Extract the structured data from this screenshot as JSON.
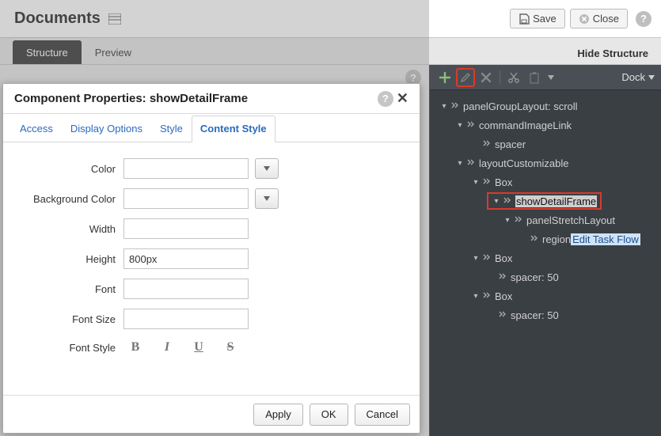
{
  "header": {
    "title": "Documents",
    "save_label": "Save",
    "close_label": "Close"
  },
  "subbar": {
    "tabs": [
      "Structure",
      "Preview"
    ],
    "active_tab": 0,
    "hide_label": "Hide Structure"
  },
  "side": {
    "dock_label": "Dock",
    "tree": [
      {
        "indent": 0,
        "expand": true,
        "label": "panelGroupLayout: scroll"
      },
      {
        "indent": 1,
        "expand": true,
        "label": "commandImageLink"
      },
      {
        "indent": 2,
        "expand": false,
        "label": "spacer"
      },
      {
        "indent": 1,
        "expand": true,
        "label": "layoutCustomizable"
      },
      {
        "indent": 2,
        "expand": true,
        "label": "Box"
      },
      {
        "indent": 3,
        "expand": true,
        "label": "showDetailFrame",
        "selected": true
      },
      {
        "indent": 4,
        "expand": true,
        "label": "panelStretchLayout"
      },
      {
        "indent": 5,
        "expand": false,
        "label": "region",
        "link_after": "Edit Task Flow"
      },
      {
        "indent": 2,
        "expand": true,
        "label": "Box"
      },
      {
        "indent": 3,
        "expand": false,
        "label": "spacer: 50"
      },
      {
        "indent": 2,
        "expand": true,
        "label": "Box"
      },
      {
        "indent": 3,
        "expand": false,
        "label": "spacer: 50"
      }
    ]
  },
  "dialog": {
    "title": "Component Properties: showDetailFrame",
    "tabs": [
      "Access",
      "Display Options",
      "Style",
      "Content Style"
    ],
    "active_tab": 3,
    "fields": {
      "color": {
        "label": "Color",
        "value": ""
      },
      "bg": {
        "label": "Background Color",
        "value": ""
      },
      "width": {
        "label": "Width",
        "value": ""
      },
      "height": {
        "label": "Height",
        "value": "800px"
      },
      "font": {
        "label": "Font",
        "value": ""
      },
      "font_size": {
        "label": "Font Size",
        "value": ""
      },
      "font_style": {
        "label": "Font Style"
      }
    },
    "buttons": {
      "apply": "Apply",
      "ok": "OK",
      "cancel": "Cancel"
    }
  }
}
